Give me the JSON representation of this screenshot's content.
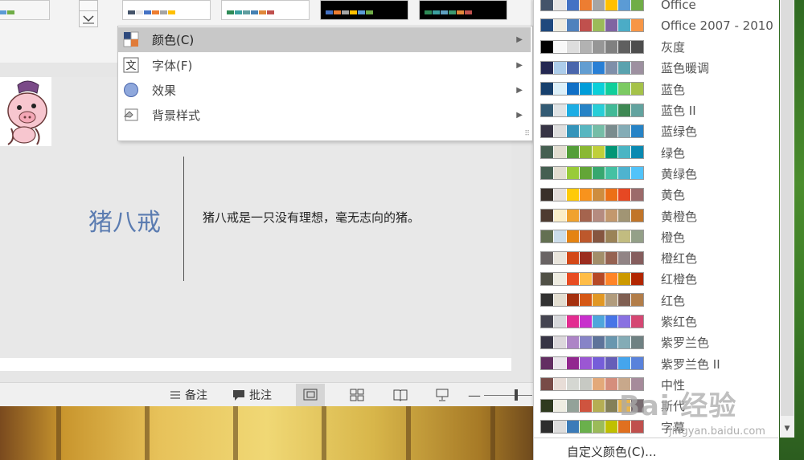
{
  "ribbon": {
    "theme_thumbs": [
      {
        "bg": "#f6f6f6",
        "colors": [
          "#4472c4",
          "#ed7d31",
          "#a5a5a5",
          "#ffc000",
          "#5b9bd5",
          "#70ad47"
        ]
      },
      {
        "bg": "#ffffff",
        "colors": [
          "#44546a",
          "#e7e6e6",
          "#4472c4",
          "#ed7d31",
          "#a5a5a5",
          "#ffc000"
        ]
      },
      {
        "bg": "#ffffff",
        "colors": [
          "#2e8b57",
          "#3aa0a0",
          "#5f9ea0",
          "#4682b4",
          "#e0883a",
          "#c0504d"
        ]
      },
      {
        "bg": "#000000",
        "colors": [
          "#4472c4",
          "#ed7d31",
          "#a5a5a5",
          "#ffc000",
          "#5b9bd5",
          "#70ad47"
        ]
      },
      {
        "bg": "#000000",
        "colors": [
          "#2e8b57",
          "#3aa0a0",
          "#5fa0c0",
          "#3d9970",
          "#e0883a",
          "#c0504d"
        ]
      }
    ]
  },
  "slide": {
    "title": "猪八戒",
    "body": "猪八戒是一只没有理想，毫无志向的猪。"
  },
  "statusbar": {
    "notes_label": "备注",
    "comments_label": "批注"
  },
  "submenu": {
    "items": [
      {
        "label": "颜色(C)",
        "icon": "theme-colors-icon",
        "highlighted": true
      },
      {
        "label": "字体(F)",
        "icon": "font-icon",
        "highlighted": false
      },
      {
        "label": "效果",
        "icon": "effects-icon",
        "highlighted": false
      },
      {
        "label": "背景样式",
        "icon": "background-style-icon",
        "highlighted": false
      }
    ]
  },
  "color_schemes": [
    {
      "name": "Office",
      "colors": [
        "#44546a",
        "#e7e6e6",
        "#4472c4",
        "#ed7d31",
        "#a5a5a5",
        "#ffc000",
        "#5b9bd5",
        "#70ad47"
      ]
    },
    {
      "name": "Office 2007 - 2010",
      "colors": [
        "#1f497d",
        "#eeece1",
        "#4f81bd",
        "#c0504d",
        "#9bbb59",
        "#8064a2",
        "#4bacc6",
        "#f79646"
      ]
    },
    {
      "name": "灰度",
      "colors": [
        "#000000",
        "#f8f8f8",
        "#dddddd",
        "#b2b2b2",
        "#969696",
        "#808080",
        "#5f5f5f",
        "#4d4d4d"
      ]
    },
    {
      "name": "蓝色暖调",
      "colors": [
        "#242852",
        "#acccea",
        "#4a66ac",
        "#629dd1",
        "#297fd5",
        "#7f8fa9",
        "#5aa2ae",
        "#9d90a0"
      ]
    },
    {
      "name": "蓝色",
      "colors": [
        "#17406d",
        "#dbeff9",
        "#0f6fc6",
        "#009dd9",
        "#0bd0d9",
        "#10cf9b",
        "#7cca62",
        "#a5c249"
      ]
    },
    {
      "name": "蓝色 II",
      "colors": [
        "#335b74",
        "#dfe3e5",
        "#1cade4",
        "#2683c6",
        "#27ced7",
        "#42ba97",
        "#3e8853",
        "#62a39f"
      ]
    },
    {
      "name": "蓝绿色",
      "colors": [
        "#373545",
        "#dedede",
        "#3494ba",
        "#58b6c0",
        "#75bda7",
        "#7a8c8e",
        "#84acb6",
        "#2683c6"
      ]
    },
    {
      "name": "绿色",
      "colors": [
        "#455f51",
        "#e3ded1",
        "#549e39",
        "#8ab833",
        "#c0cf3a",
        "#029676",
        "#4ab5c4",
        "#0989b1"
      ]
    },
    {
      "name": "黄绿色",
      "colors": [
        "#455f51",
        "#e3ded1",
        "#99cb38",
        "#63a537",
        "#37a76f",
        "#44c1a3",
        "#4eb3cf",
        "#51c3f9"
      ]
    },
    {
      "name": "黄色",
      "colors": [
        "#39302a",
        "#e5dedb",
        "#ffca08",
        "#f8931d",
        "#ce8d3e",
        "#ec7016",
        "#e64823",
        "#9c6a6a"
      ]
    },
    {
      "name": "黄橙色",
      "colors": [
        "#4e3b30",
        "#fbeec9",
        "#f0a22e",
        "#a5644e",
        "#b58b80",
        "#c3986d",
        "#a19574",
        "#c17529"
      ]
    },
    {
      "name": "橙色",
      "colors": [
        "#637052",
        "#ccddea",
        "#e48312",
        "#bd582c",
        "#865640",
        "#9b8357",
        "#c2bc80",
        "#94a088"
      ]
    },
    {
      "name": "橙红色",
      "colors": [
        "#696464",
        "#e9e5dc",
        "#d34817",
        "#9b2d1f",
        "#a28e6a",
        "#956251",
        "#918485",
        "#855d5d"
      ]
    },
    {
      "name": "红橙色",
      "colors": [
        "#505046",
        "#eeece1",
        "#e84c22",
        "#ffbd47",
        "#b64926",
        "#ff8427",
        "#cc9900",
        "#b22600"
      ]
    },
    {
      "name": "红色",
      "colors": [
        "#323232",
        "#e3ded1",
        "#a5300f",
        "#d55816",
        "#e19825",
        "#b19c7d",
        "#7f5f52",
        "#b27d49"
      ]
    },
    {
      "name": "紫红色",
      "colors": [
        "#454551",
        "#d8d9dc",
        "#e32d91",
        "#c830cc",
        "#4ea6dc",
        "#4775e7",
        "#8971e1",
        "#d54773"
      ]
    },
    {
      "name": "紫罗兰色",
      "colors": [
        "#373545",
        "#dcd8dc",
        "#ad84c6",
        "#8784c7",
        "#5d739a",
        "#6997af",
        "#84acb6",
        "#6f8183"
      ]
    },
    {
      "name": "紫罗兰色 II",
      "colors": [
        "#632e62",
        "#eae5eb",
        "#92278f",
        "#9b57d3",
        "#755dd9",
        "#665eb8",
        "#45a5ed",
        "#5982db"
      ]
    },
    {
      "name": "中性",
      "colors": [
        "#784b47",
        "#e8ddd7",
        "#d5d7d2",
        "#c7c9c3",
        "#e3a979",
        "#d58e7c",
        "#c8a88b",
        "#a68b9b"
      ]
    },
    {
      "name": "斯代",
      "colors": [
        "#2f3a1f",
        "#eeede2",
        "#93a299",
        "#cf543f",
        "#b5ae53",
        "#848058",
        "#e8b54d",
        "#786c71"
      ]
    },
    {
      "name": "字幕",
      "colors": [
        "#2e2e2e",
        "#dddddd",
        "#3b7bb8",
        "#6ab04c",
        "#9bbb59",
        "#c0c000",
        "#e07020",
        "#c0504d"
      ]
    }
  ],
  "custom_colors_label": "自定义颜色(C)...",
  "watermark": {
    "main": "Bai 经验",
    "sub": "jingyan.baidu.com"
  }
}
